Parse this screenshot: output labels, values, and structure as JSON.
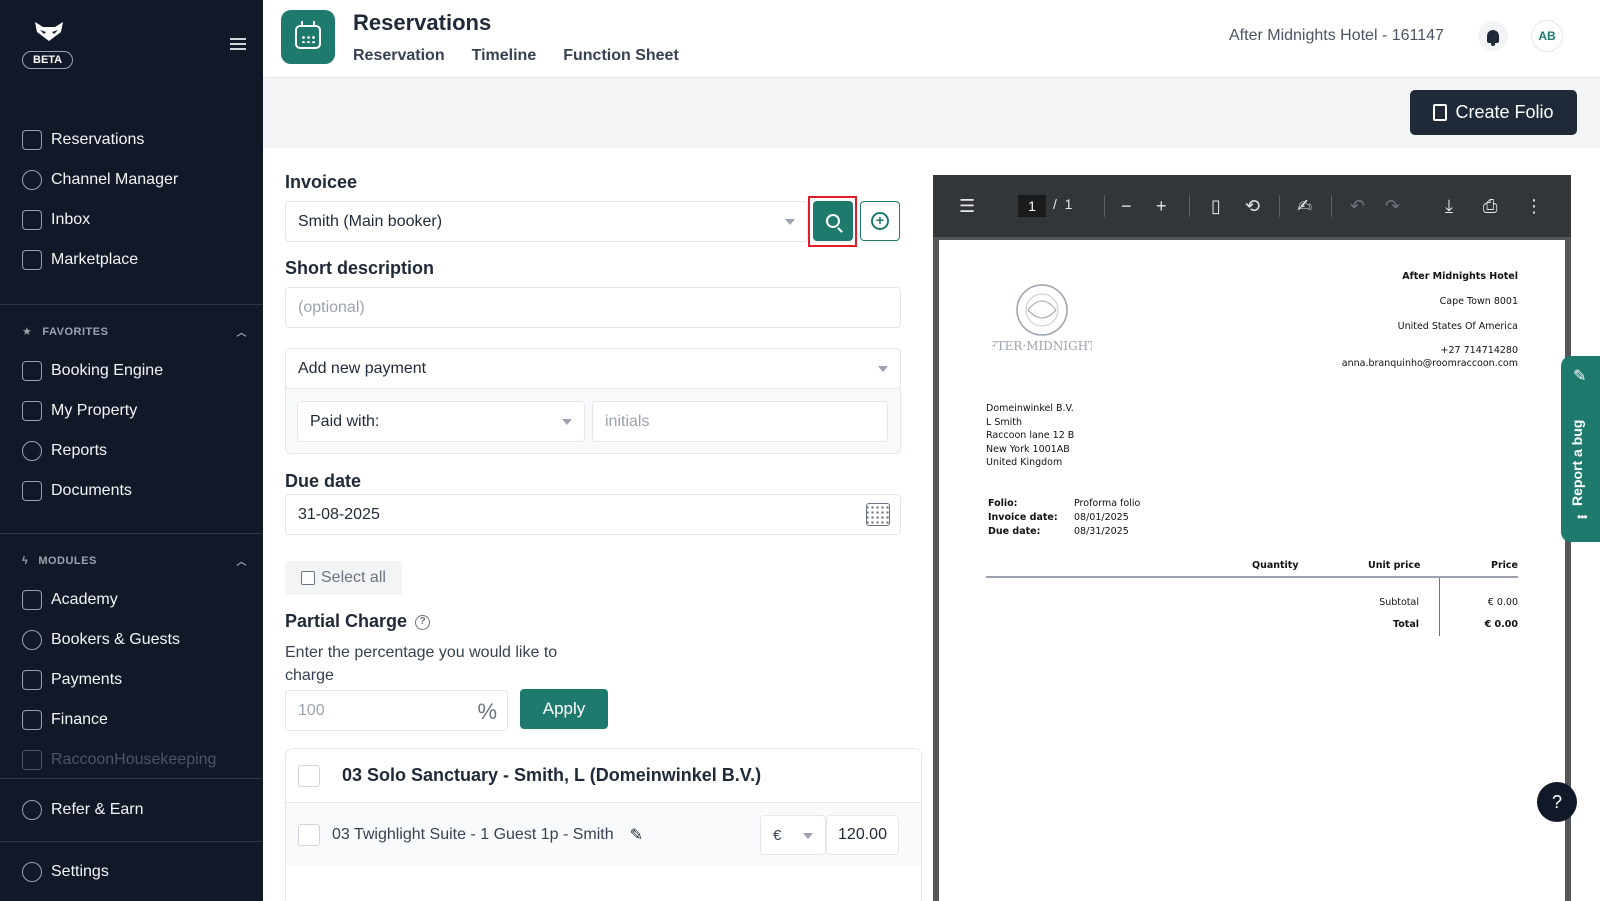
{
  "sidebar": {
    "beta_label": "BETA",
    "main_items": [
      {
        "label": "Reservations",
        "icon": "calendar-icon"
      },
      {
        "label": "Channel Manager",
        "icon": "channel-manager-icon"
      },
      {
        "label": "Inbox",
        "icon": "inbox-icon"
      },
      {
        "label": "Marketplace",
        "icon": "marketplace-icon"
      }
    ],
    "favorites_header": "FAVORITES",
    "favorites": [
      {
        "label": "Booking Engine",
        "icon": "booking-engine-icon"
      },
      {
        "label": "My Property",
        "icon": "property-icon"
      },
      {
        "label": "Reports",
        "icon": "reports-icon"
      },
      {
        "label": "Documents",
        "icon": "documents-icon"
      }
    ],
    "modules_header": "MODULES",
    "modules": [
      {
        "label": "Academy",
        "icon": "academy-icon"
      },
      {
        "label": "Bookers & Guests",
        "icon": "guests-icon"
      },
      {
        "label": "Payments",
        "icon": "payments-icon"
      },
      {
        "label": "Finance",
        "icon": "finance-icon"
      },
      {
        "label": "RaccoonHousekeeping",
        "icon": "housekeeping-icon"
      }
    ],
    "refer_label": "Refer & Earn",
    "settings_label": "Settings"
  },
  "header": {
    "title": "Reservations",
    "tabs": [
      "Reservation",
      "Timeline",
      "Function Sheet"
    ],
    "hotel": "After Midnights Hotel - 161147",
    "avatar_initials": "AB"
  },
  "actions": {
    "create_folio": "Create Folio"
  },
  "form": {
    "invoicee_label": "Invoicee",
    "invoicee_value": "Smith (Main booker)",
    "short_description_label": "Short description",
    "short_description_placeholder": "(optional)",
    "payment_select": "Add new payment",
    "paid_with": "Paid with:",
    "initials_placeholder": "initials",
    "due_date_label": "Due date",
    "due_date_value": "31-08-2025",
    "select_all": "Select all",
    "partial_charge_label": "Partial Charge",
    "partial_charge_hint": "Enter the percentage you would like to charge",
    "percentage_placeholder": "100",
    "percent_sign": "%",
    "apply": "Apply"
  },
  "room": {
    "title": "03 Solo Sanctuary - Smith, L (Domeinwinkel B.V.)",
    "line_label": "03 Twighlight Suite - 1 Guest 1p - Smith",
    "currency": "€",
    "amount": "120.00"
  },
  "pdf": {
    "page_current": "1",
    "page_total": "1",
    "hotel_logo_text": "AFTER·MIDNIGHTS",
    "hotel_name": "After Midnights Hotel",
    "hotel_city": "Cape Town 8001",
    "hotel_country": "United States Of America",
    "hotel_phone": "+27 714714280",
    "hotel_email": "anna.branquinho@roomraccoon.com",
    "recipient": [
      "Domeinwinkel B.V.",
      "L Smith",
      "Raccoon lane 12 B",
      "New York  1001AB",
      "United Kingdom"
    ],
    "folio_label": "Folio:",
    "folio_value": "Proforma folio",
    "invoice_date_label": "Invoice date:",
    "invoice_date_value": "08/01/2025",
    "due_date_label": "Due date:",
    "due_date_value": "08/31/2025",
    "col_quantity": "Quantity",
    "col_unit_price": "Unit price",
    "col_price": "Price",
    "subtotal_label": "Subtotal",
    "subtotal_value": "€ 0.00",
    "total_label": "Total",
    "total_value": "€ 0.00"
  },
  "report_bug": "Report a bug",
  "help_label": "?"
}
